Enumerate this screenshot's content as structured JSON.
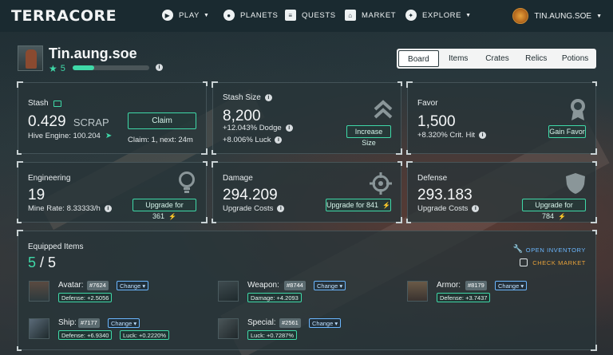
{
  "nav": {
    "logo": "TERRACORE",
    "items": [
      {
        "label": "PLAY",
        "icon": "play-icon",
        "caret": true
      },
      {
        "label": "PLANETS",
        "icon": "planet-icon",
        "caret": false
      },
      {
        "label": "QUESTS",
        "icon": "quests-icon",
        "caret": false
      },
      {
        "label": "MARKET",
        "icon": "market-icon",
        "caret": false
      },
      {
        "label": "EXPLORE",
        "icon": "compass-icon",
        "caret": true
      }
    ],
    "user": "TIN.AUNG.SOE"
  },
  "profile": {
    "name": "Tin.aung.soe",
    "level": "5",
    "xp_progress": 0.28
  },
  "tabs": [
    "Board",
    "Items",
    "Crates",
    "Relics",
    "Potions"
  ],
  "active_tab": "Board",
  "stash": {
    "label": "Stash",
    "value": "0.429",
    "unit": "SCRAP",
    "hive_engine": "Hive Engine: 100.204",
    "claim_button": "Claim",
    "claim_info": "Claim: 1, next: 24m"
  },
  "stash_size": {
    "label": "Stash Size",
    "value": "8,200",
    "dodge": "+12.043% Dodge",
    "luck": "+8.006% Luck",
    "button": "Increase Size"
  },
  "favor": {
    "label": "Favor",
    "value": "1,500",
    "crit": "+8.320% Crit. Hit",
    "button": "Gain Favor"
  },
  "engineering": {
    "label": "Engineering",
    "value": "19",
    "mine_rate": "Mine Rate: 8.33333/h",
    "button": "Upgrade for 361"
  },
  "damage": {
    "label": "Damage",
    "value": "294.209",
    "sub": "Upgrade Costs",
    "button": "Upgrade for 841"
  },
  "defense": {
    "label": "Defense",
    "value": "293.183",
    "sub": "Upgrade Costs",
    "button": "Upgrade for 784"
  },
  "equipped": {
    "title": "Equipped Items",
    "current": "5",
    "separator": " / ",
    "total": "5",
    "open_inventory": "OPEN INVENTORY",
    "check_market": "CHECK MARKET",
    "change_label": "Change ▾",
    "slots": [
      {
        "name": "Avatar:",
        "id": "#7624",
        "stats": [
          "Defense: +2.5056"
        ]
      },
      {
        "name": "Weapon:",
        "id": "#8744",
        "stats": [
          "Damage: +4.2093"
        ]
      },
      {
        "name": "Armor:",
        "id": "#8179",
        "stats": [
          "Defense: +3.7437"
        ]
      },
      {
        "name": "Ship:",
        "id": "#7177",
        "stats": [
          "Defense: +6.9340",
          "Luck: +0.2220%"
        ]
      },
      {
        "name": "Special:",
        "id": "#2561",
        "stats": [
          "Luck: +0.7287%"
        ]
      }
    ]
  },
  "colors": {
    "accent": "#3fd9a8",
    "link_blue": "#6bb7ff",
    "market_orange": "#e8a23a"
  }
}
